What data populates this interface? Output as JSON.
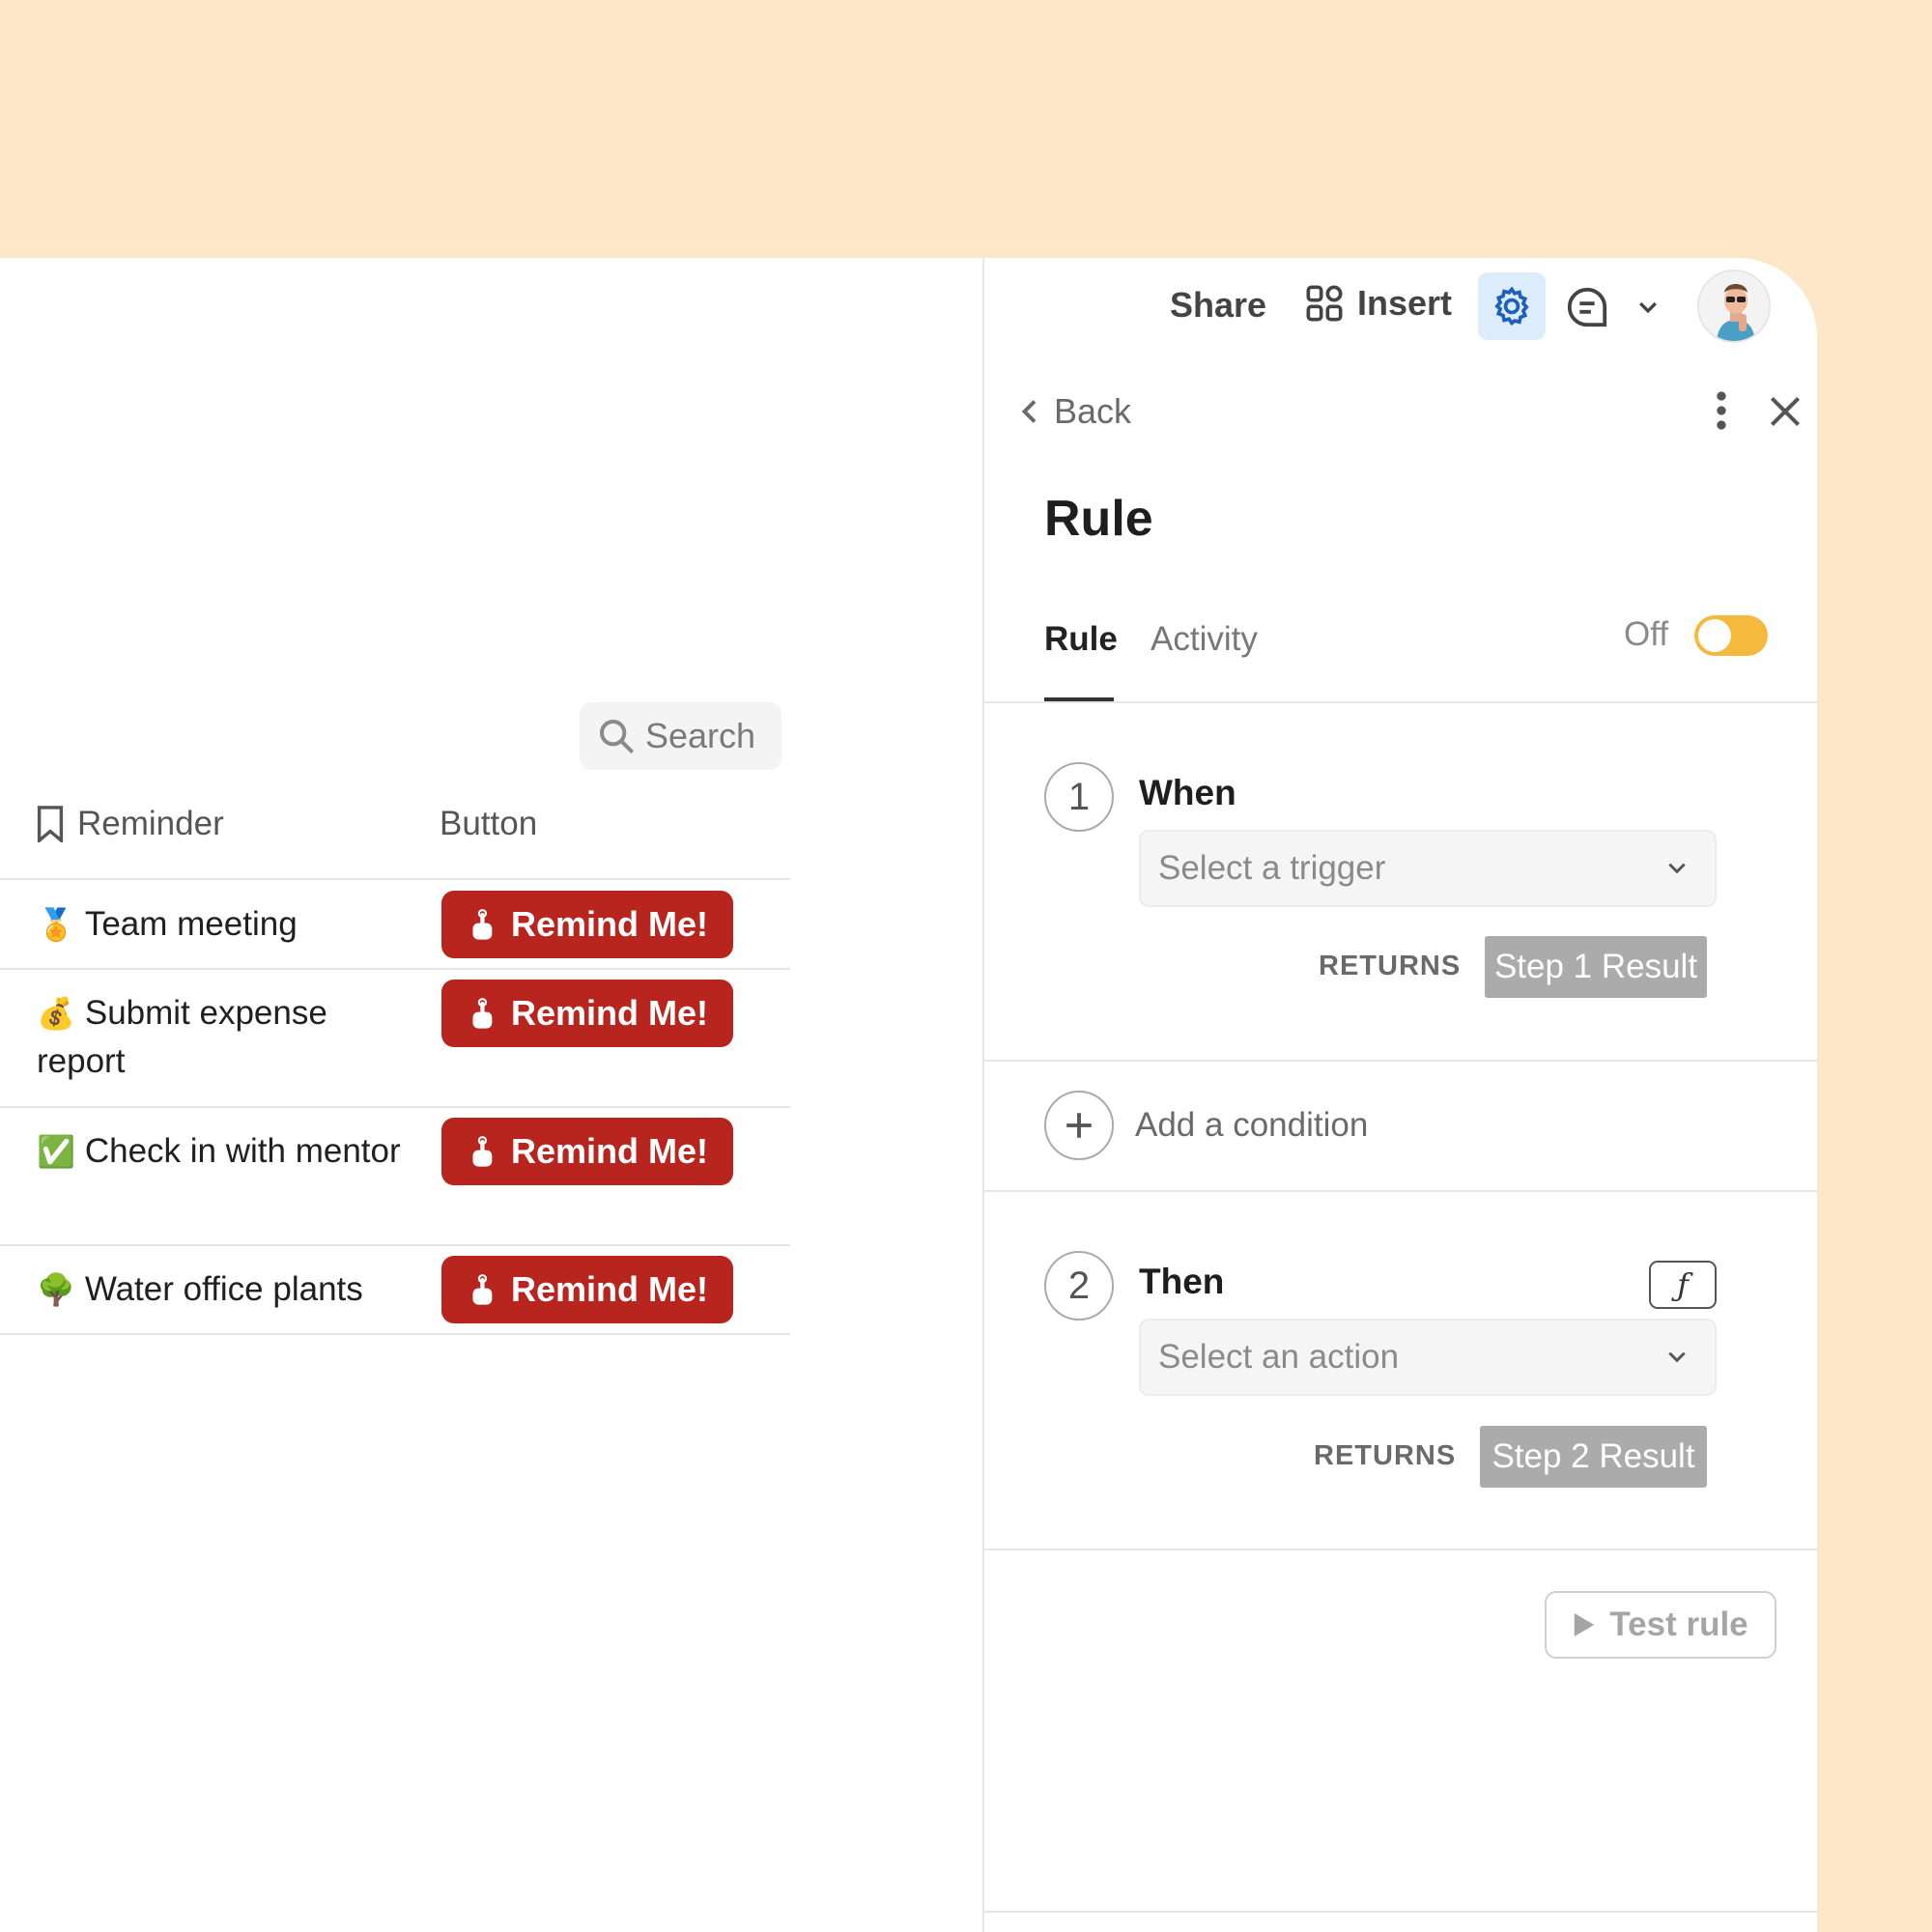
{
  "left": {
    "search_label": "Search",
    "columns": {
      "reminder": "Reminder",
      "button": "Button"
    },
    "rows": [
      {
        "emoji": "🏅",
        "text": "Team meeting",
        "button": "Remind Me!"
      },
      {
        "emoji": "💰",
        "text": "Submit expense report",
        "button": "Remind Me!"
      },
      {
        "emoji": "✅",
        "text": "Check in with mentor",
        "button": "Remind Me!"
      },
      {
        "emoji": "🌳",
        "text": "Water office plants",
        "button": "Remind Me!"
      }
    ],
    "button_color": "#b8241e"
  },
  "toolbar": {
    "share": "Share",
    "insert": "Insert",
    "icons": [
      "insert-grid-icon",
      "gear-icon",
      "comment-icon",
      "chevron-down-icon"
    ]
  },
  "panel": {
    "back": "Back",
    "title": "Rule",
    "tabs": [
      {
        "label": "Rule",
        "active": true
      },
      {
        "label": "Activity",
        "active": false
      }
    ],
    "toggle_label": "Off",
    "toggle_color": "#f4b93d",
    "steps": [
      {
        "number": "1",
        "title": "When",
        "placeholder": "Select a trigger",
        "returns_label": "RETURNS",
        "result": "Step 1 Result"
      },
      {
        "number": "2",
        "title": "Then",
        "placeholder": "Select an action",
        "returns_label": "RETURNS",
        "result": "Step 2 Result"
      }
    ],
    "add_condition": "Add a condition",
    "fx_label": "ƒ",
    "test_rule": "Test rule"
  }
}
